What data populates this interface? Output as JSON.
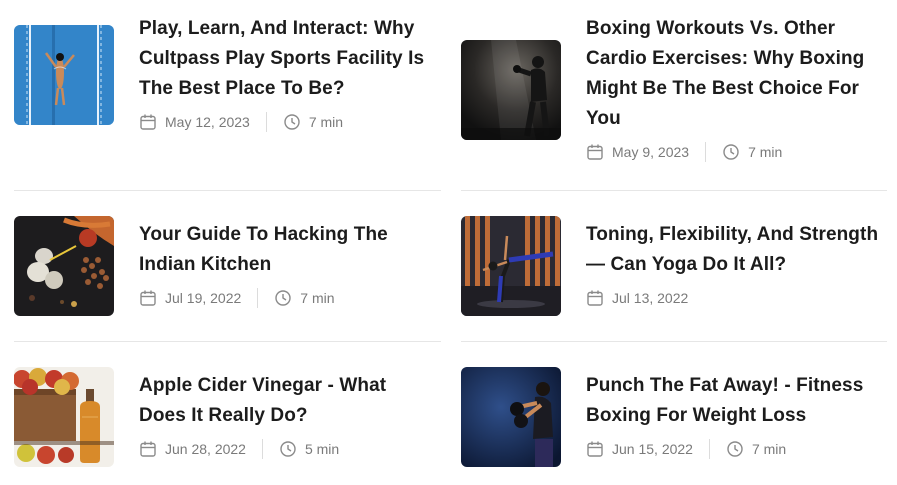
{
  "articles": [
    {
      "title": "Play, Learn, And Interact: Why Cultpass Play Sports Facility Is The Best Place To Be?",
      "date": "May 12, 2023",
      "read_time": "7 min",
      "image": "swimmer-in-pool"
    },
    {
      "title": "Boxing Workouts Vs. Other Cardio Exercises: Why Boxing Might Be The Best Choice For You",
      "date": "May 9, 2023",
      "read_time": "7 min",
      "image": "boxer-in-dark-room"
    },
    {
      "title": "Your Guide To Hacking The Indian Kitchen",
      "date": "Jul 19, 2022",
      "read_time": "7 min",
      "image": "garlic-and-spices"
    },
    {
      "title": "Toning, Flexibility, And Strength— Can Yoga Do It All?",
      "date": "Jul 13, 2022",
      "read_time": "7 min",
      "image": "yoga-pose"
    },
    {
      "title": "Apple Cider Vinegar - What Does It Really Do?",
      "date": "Jun 28, 2022",
      "read_time": "5 min",
      "image": "apples-and-vinegar-bottle"
    },
    {
      "title": "Punch The Fat Away! - Fitness Boxing For Weight Loss",
      "date": "Jun 15, 2022",
      "read_time": "7 min",
      "image": "woman-boxing"
    }
  ],
  "colors": {
    "title": "#1c1c1c",
    "meta": "#7a7a7a",
    "divider": "#e6e6e6"
  }
}
